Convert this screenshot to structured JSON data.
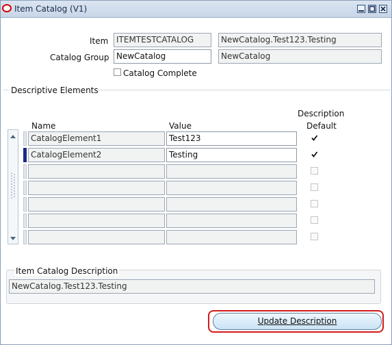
{
  "window": {
    "title": "Item Catalog (V1)"
  },
  "form": {
    "item_label": "Item",
    "item_value": "ITEMTESTCATALOG",
    "item_description": "NewCatalog.Test123.Testing",
    "catalog_group_label": "Catalog Group",
    "catalog_group_value": "NewCatalog",
    "catalog_group_description": "NewCatalog",
    "catalog_complete_label": "Catalog Complete",
    "catalog_complete_checked": false
  },
  "elements": {
    "section_label": "Descriptive Elements",
    "columns": {
      "name": "Name",
      "value": "Value",
      "default_line1": "Description",
      "default_line2": "Default"
    },
    "rows": [
      {
        "name": "CatalogElement1",
        "value": "Test123",
        "default": true
      },
      {
        "name": "CatalogElement2",
        "value": "Testing",
        "default": true
      },
      {
        "name": "",
        "value": "",
        "default": false
      },
      {
        "name": "",
        "value": "",
        "default": false
      },
      {
        "name": "",
        "value": "",
        "default": false
      },
      {
        "name": "",
        "value": "",
        "default": false
      },
      {
        "name": "",
        "value": "",
        "default": false
      }
    ]
  },
  "description": {
    "section_label": "Item Catalog Description",
    "value": "NewCatalog.Test123.Testing"
  },
  "actions": {
    "update_description_label": "Update Description"
  },
  "colors": {
    "highlight": "#d31919",
    "current_row": "#1c2a8a",
    "title_icon": "#d00000"
  }
}
